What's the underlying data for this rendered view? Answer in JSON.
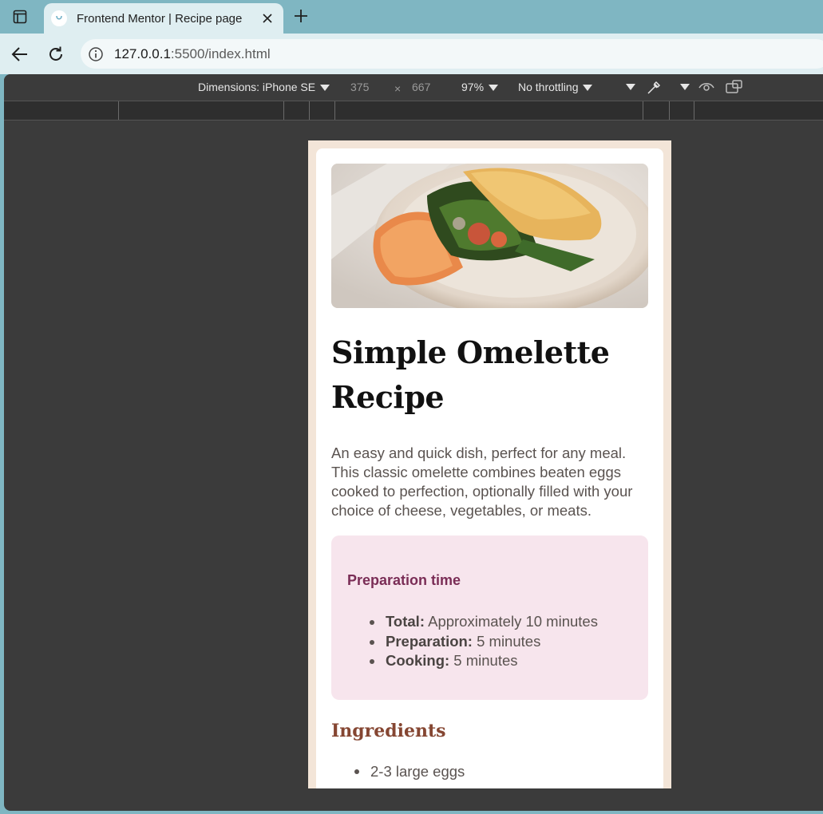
{
  "browser": {
    "tab_title": "Frontend Mentor | Recipe page",
    "url_host": "127.0.0.1",
    "url_rest": ":5500/index.html"
  },
  "devtools": {
    "dimensions_label": "Dimensions: iPhone SE",
    "width": "375",
    "times": "×",
    "height": "667",
    "zoom": "97%",
    "throttling": "No throttling"
  },
  "recipe": {
    "title": "Simple Omelette Recipe",
    "intro": "An easy and quick dish, perfect for any meal. This classic omelette combines beaten eggs cooked to perfection, optionally filled with your choice of cheese, vegetables, or meats.",
    "prep": {
      "title": "Preparation time",
      "items": [
        {
          "label": "Total:",
          "value": " Approximately 10 minutes"
        },
        {
          "label": "Preparation:",
          "value": " 5 minutes"
        },
        {
          "label": "Cooking:",
          "value": " 5 minutes"
        }
      ]
    },
    "ingredients": {
      "title": "Ingredients",
      "items": [
        "2-3 large eggs"
      ]
    }
  },
  "colors": {
    "browser_frame": "#7fb6c2",
    "page_bg": "#f3e5d8",
    "prep_bg": "#f7e5ed",
    "prep_title": "#7a2d56",
    "ingredients_title": "#854632"
  }
}
